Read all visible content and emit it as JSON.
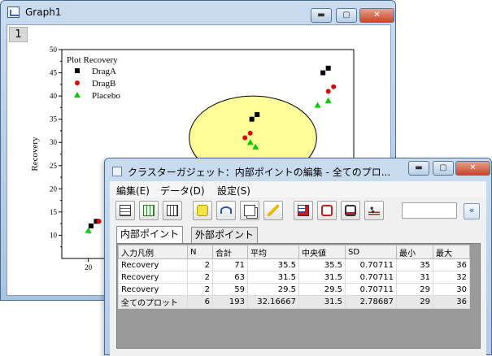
{
  "graph_window": {
    "title": "Graph1",
    "layer_tab": "1",
    "controls": {
      "minimize": "▬",
      "maximize": "▢",
      "close": "✕"
    }
  },
  "chart_data": {
    "type": "scatter",
    "ylabel": "Recovery",
    "ylim": [
      5,
      50
    ],
    "xlim": [
      15,
      70
    ],
    "y_ticks": [
      "10",
      "15",
      "20",
      "25",
      "30",
      "35",
      "40",
      "45",
      "50"
    ],
    "x_ticks": [
      "20"
    ],
    "legend_title": "Plot Recovery",
    "legend_position": "top-left",
    "series": [
      {
        "name": "DragA",
        "color": "#000000",
        "marker": "square",
        "x": [
          20.5,
          21.5,
          50.8,
          51.8,
          64.2,
          65.2
        ],
        "y": [
          12,
          13,
          35,
          36,
          45,
          46
        ]
      },
      {
        "name": "DragB",
        "color": "#e00000",
        "marker": "circle",
        "x": [
          22,
          49.5,
          50.5,
          65.2,
          66.2
        ],
        "y": [
          13,
          31,
          32,
          41,
          42
        ]
      },
      {
        "name": "Placebo",
        "color": "#00cc00",
        "marker": "triangle",
        "x": [
          20,
          50.5,
          51.5,
          63.2,
          65.2
        ],
        "y": [
          11,
          30,
          29,
          38,
          39
        ]
      }
    ],
    "annotation": {
      "shape": "ellipse",
      "fill": "#ffff99",
      "stroke": "#000000",
      "center": [
        51,
        31
      ],
      "radius_x": 12,
      "radius_y": 9
    }
  },
  "dialog": {
    "title": "クラスターガジェット：内部ポイントの編集 - 全てのプロ...",
    "controls": {
      "minimize": "▬",
      "maximize": "▢",
      "close": "✕"
    },
    "menu": [
      "編集(E)",
      "データ(D)",
      "設定(S)"
    ],
    "tabs": [
      "内部ポイント",
      "外部ポイント"
    ],
    "active_tab": 0,
    "search_value": "",
    "expand_icon": "«",
    "table": {
      "headers": [
        "入力凡例",
        "N",
        "合計",
        "平均",
        "中央値",
        "SD",
        "最小",
        "最大"
      ],
      "rows": [
        [
          "Recovery",
          "2",
          "71",
          "35.5",
          "35.5",
          "0.70711",
          "35",
          "36"
        ],
        [
          "Recovery",
          "2",
          "63",
          "31.5",
          "31.5",
          "0.70711",
          "31",
          "32"
        ],
        [
          "Recovery",
          "2",
          "59",
          "29.5",
          "29.5",
          "0.70711",
          "29",
          "30"
        ],
        [
          "全てのプロット",
          "6",
          "193",
          "32.16667",
          "31.5",
          "2.78687",
          "29",
          "36"
        ]
      ]
    }
  }
}
